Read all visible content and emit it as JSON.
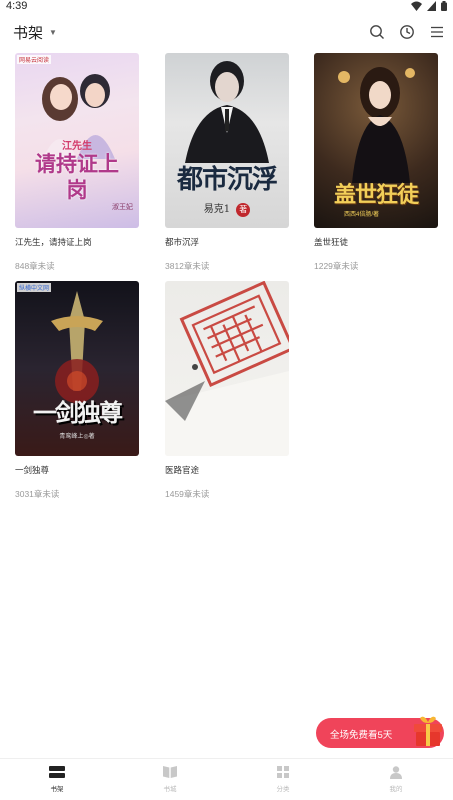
{
  "status": {
    "time": "4:39"
  },
  "header": {
    "title": "书架"
  },
  "colors": {
    "accent": "#f0445a",
    "text": "#333333",
    "muted": "#999999",
    "tab_inactive": "#bbbbbb"
  },
  "books": [
    {
      "title": "江先生，请持证上岗",
      "progress": "848章未读",
      "cover": {
        "publisher": "网易云阅读",
        "top_text": "江先生",
        "main_text": "请持证上岗",
        "author": "淑王妃"
      }
    },
    {
      "title": "都市沉浮",
      "progress": "3812章未读",
      "cover": {
        "main_text": "都市沉浮",
        "author": "易克1",
        "author_suffix": "著"
      }
    },
    {
      "title": "盖世狂徒",
      "progress": "1229章未读",
      "cover": {
        "main_text": "盖世狂徒",
        "author": "西西4倍肠/著"
      }
    },
    {
      "title": "一剑独尊",
      "progress": "3031章未读",
      "cover": {
        "publisher": "纵横中文网",
        "main_text": "一剑独尊",
        "author": "青鸾峰上◎著"
      }
    },
    {
      "title": "医路官途",
      "progress": "1459章未读",
      "cover": {}
    }
  ],
  "promo": {
    "text": "全场免费看5天"
  },
  "tabs": [
    {
      "label": "书架",
      "icon": "bookshelf-icon",
      "active": true
    },
    {
      "label": "书城",
      "icon": "book-open-icon",
      "active": false
    },
    {
      "label": "分类",
      "icon": "grid-icon",
      "active": false
    },
    {
      "label": "我的",
      "icon": "person-icon",
      "active": false
    }
  ]
}
